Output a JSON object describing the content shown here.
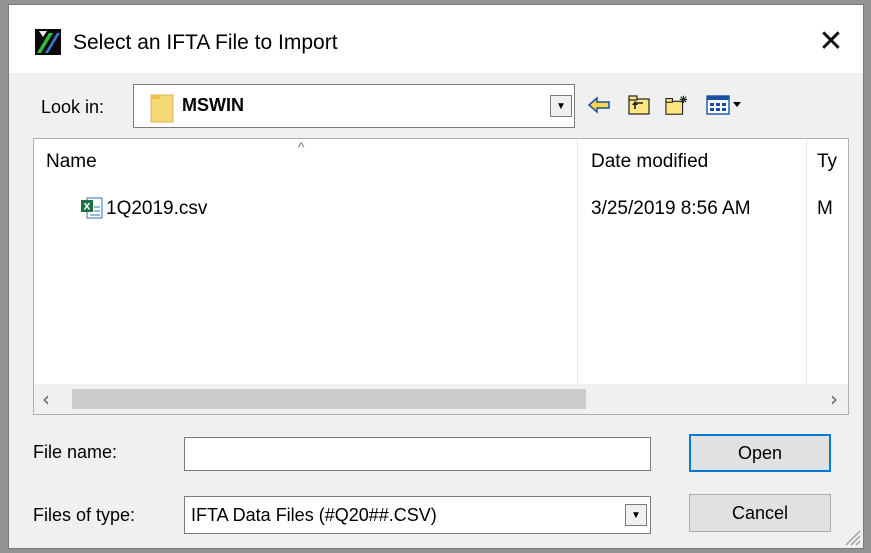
{
  "window": {
    "title": "Select an IFTA File to Import",
    "close_glyph": "✕"
  },
  "lookin": {
    "label": "Look in:",
    "value": "MSWIN"
  },
  "toolbar": {
    "icons": [
      "back-icon",
      "up-folder-icon",
      "new-folder-icon",
      "view-menu-icon"
    ]
  },
  "list": {
    "columns": [
      "Name",
      "Date modified",
      "Ty"
    ],
    "sort_glyph": "^",
    "files": [
      {
        "name": "1Q2019.csv",
        "date": "3/25/2019 8:56 AM",
        "type": "M"
      }
    ]
  },
  "form": {
    "filename_label": "File name:",
    "filename_value": "",
    "filetype_label": "Files of type:",
    "filetype_value": "IFTA Data Files (#Q20##.CSV)"
  },
  "buttons": {
    "open": "Open",
    "cancel": "Cancel"
  },
  "colors": {
    "accent": "#0078d7",
    "folder": "#f8d775",
    "excel_green": "#1d7044"
  }
}
